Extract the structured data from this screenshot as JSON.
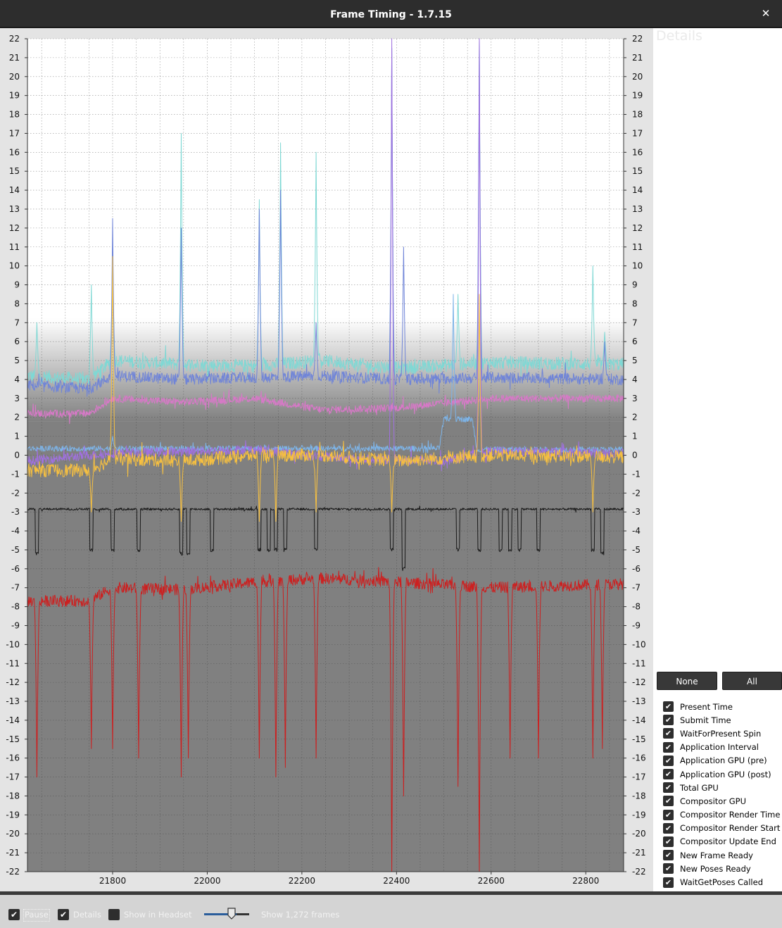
{
  "window": {
    "title": "Frame Timing - 1.7.15",
    "close_glyph": "✕"
  },
  "chart_data": {
    "type": "line",
    "title": "",
    "xlabel": "",
    "ylabel": "",
    "xlim": [
      21620,
      22880
    ],
    "ylim": [
      -22,
      22
    ],
    "x_ticks": [
      21800,
      22000,
      22200,
      22400,
      22600,
      22800
    ],
    "y_ticks": [
      -22,
      -21,
      -20,
      -19,
      -18,
      -17,
      -16,
      -15,
      -14,
      -13,
      -12,
      -11,
      -10,
      -9,
      -8,
      -7,
      -6,
      -5,
      -4,
      -3,
      -2,
      -1,
      0,
      1,
      2,
      3,
      4,
      5,
      6,
      7,
      8,
      9,
      10,
      11,
      12,
      13,
      14,
      15,
      16,
      17,
      18,
      19,
      20,
      21,
      22
    ],
    "grid": true,
    "background": {
      "bands": [
        {
          "from": 22,
          "to": 7.2,
          "color": "#ffffff"
        },
        {
          "from": 7.2,
          "to": 1.8,
          "color": "gradient-white-to-grey"
        },
        {
          "from": 1.8,
          "to": -22,
          "color": "#808080"
        }
      ]
    },
    "spikes_x": [
      21640,
      21755,
      21800,
      21855,
      21945,
      22110,
      22145,
      22165,
      22230,
      22390,
      22415,
      22530,
      22575,
      22640,
      22700,
      22815,
      22835
    ],
    "series": [
      {
        "name": "Total GPU",
        "color": "#7fd8d4",
        "baseline": [
          [
            21620,
            4.2
          ],
          [
            21750,
            4.0
          ],
          [
            21800,
            5.0
          ],
          [
            21950,
            4.8
          ],
          [
            22100,
            4.7
          ],
          [
            22240,
            5.0
          ],
          [
            22400,
            4.6
          ],
          [
            22600,
            4.9
          ],
          [
            22880,
            4.8
          ]
        ],
        "noise": 0.35,
        "spikes": [
          [
            21640,
            7.0
          ],
          [
            21755,
            9.0
          ],
          [
            21800,
            11.0
          ],
          [
            21945,
            17.0
          ],
          [
            22110,
            13.5
          ],
          [
            22155,
            16.5
          ],
          [
            22230,
            16.0
          ],
          [
            22390,
            21.5
          ],
          [
            22530,
            8.5
          ],
          [
            22575,
            22
          ],
          [
            22815,
            10.0
          ],
          [
            22840,
            6.5
          ]
        ]
      },
      {
        "name": "Application GPU (post)",
        "color": "#6f84d8",
        "baseline": [
          [
            21620,
            3.7
          ],
          [
            21750,
            3.5
          ],
          [
            21800,
            4.2
          ],
          [
            21950,
            4.0
          ],
          [
            22100,
            4.1
          ],
          [
            22240,
            4.2
          ],
          [
            22400,
            4.0
          ],
          [
            22600,
            4.1
          ],
          [
            22880,
            4.0
          ]
        ],
        "noise": 0.3,
        "spikes": [
          [
            21800,
            12.5
          ],
          [
            21945,
            12.0
          ],
          [
            22110,
            13.0
          ],
          [
            22155,
            14.0
          ],
          [
            22230,
            7.0
          ],
          [
            22390,
            21.5
          ],
          [
            22415,
            11.0
          ],
          [
            22575,
            22
          ],
          [
            22840,
            6.0
          ]
        ]
      },
      {
        "name": "Application GPU (pre)",
        "color": "#d878c8",
        "baseline": [
          [
            21620,
            2.2
          ],
          [
            21750,
            2.2
          ],
          [
            21800,
            3.0
          ],
          [
            21950,
            2.8
          ],
          [
            22100,
            3.0
          ],
          [
            22240,
            2.4
          ],
          [
            22400,
            2.5
          ],
          [
            22600,
            3.0
          ],
          [
            22880,
            3.0
          ]
        ],
        "noise": 0.2,
        "spikes": []
      },
      {
        "name": "Compositor GPU",
        "color": "#7db4e8",
        "baseline": [
          [
            21620,
            0.35
          ],
          [
            22490,
            0.35
          ],
          [
            22500,
            1.9
          ],
          [
            22560,
            1.9
          ],
          [
            22570,
            0.3
          ],
          [
            22880,
            0.3
          ]
        ],
        "noise": 0.15,
        "spikes": [
          [
            21800,
            1.0
          ],
          [
            22520,
            8.5
          ]
        ]
      },
      {
        "name": "Application Interval",
        "color": "#a070e0",
        "baseline": [
          [
            21620,
            -0.3
          ],
          [
            21800,
            0.1
          ],
          [
            22100,
            0.3
          ],
          [
            22300,
            -0.2
          ],
          [
            22500,
            -0.3
          ],
          [
            22600,
            0.2
          ],
          [
            22880,
            0.1
          ]
        ],
        "noise": 0.25,
        "spikes": [
          [
            22390,
            22
          ],
          [
            22575,
            22
          ]
        ]
      },
      {
        "name": "Present Time",
        "color": "#f7c040",
        "baseline": [
          [
            21620,
            -0.8
          ],
          [
            21750,
            -0.8
          ],
          [
            21800,
            -0.2
          ],
          [
            21950,
            -0.3
          ],
          [
            22100,
            0.0
          ],
          [
            22240,
            0.0
          ],
          [
            22400,
            -0.3
          ],
          [
            22600,
            0.0
          ],
          [
            22880,
            -0.1
          ]
        ],
        "noise": 0.35,
        "spikes": [
          [
            21755,
            -3.0
          ],
          [
            21800,
            10.5
          ],
          [
            21945,
            -3.5
          ],
          [
            22110,
            -3.5
          ],
          [
            22145,
            -3.5
          ],
          [
            22230,
            -3.0
          ],
          [
            22390,
            -3.0
          ],
          [
            22575,
            8.5
          ],
          [
            22815,
            -3.0
          ]
        ]
      },
      {
        "name": "New Frame Ready",
        "color": "#1a1a1a",
        "baseline": [
          [
            21620,
            -2.85
          ],
          [
            22880,
            -2.85
          ]
        ],
        "noise": 0.06,
        "drops": [
          [
            21640,
            -5.2
          ],
          [
            21755,
            -5.0
          ],
          [
            21800,
            -5.0
          ],
          [
            21855,
            -5.0
          ],
          [
            21945,
            -5.2
          ],
          [
            21960,
            -5.2
          ],
          [
            22010,
            -5.0
          ],
          [
            22110,
            -5.0
          ],
          [
            22130,
            -5.0
          ],
          [
            22145,
            -5.0
          ],
          [
            22165,
            -5.0
          ],
          [
            22230,
            -5.0
          ],
          [
            22390,
            -5.0
          ],
          [
            22415,
            -6.0
          ],
          [
            22530,
            -5.0
          ],
          [
            22575,
            -5.0
          ],
          [
            22620,
            -5.0
          ],
          [
            22640,
            -5.0
          ],
          [
            22660,
            -5.0
          ],
          [
            22700,
            -5.0
          ],
          [
            22815,
            -5.0
          ],
          [
            22835,
            -5.2
          ]
        ]
      },
      {
        "name": "WaitForPresent Spin",
        "color": "#cc2020",
        "baseline": [
          [
            21620,
            -7.7
          ],
          [
            21750,
            -7.7
          ],
          [
            21800,
            -7.0
          ],
          [
            21950,
            -7.1
          ],
          [
            22100,
            -6.7
          ],
          [
            22240,
            -6.5
          ],
          [
            22400,
            -6.7
          ],
          [
            22600,
            -7.0
          ],
          [
            22880,
            -6.8
          ]
        ],
        "noise": 0.3,
        "spikes": [
          [
            21640,
            -17.0
          ],
          [
            21755,
            -15.5
          ],
          [
            21800,
            -15.5
          ],
          [
            21855,
            -16.0
          ],
          [
            21945,
            -17.0
          ],
          [
            21960,
            -16.0
          ],
          [
            22110,
            -16.0
          ],
          [
            22145,
            -17.0
          ],
          [
            22165,
            -16.5
          ],
          [
            22230,
            -16.0
          ],
          [
            22390,
            -22
          ],
          [
            22415,
            -18.0
          ],
          [
            22530,
            -17.5
          ],
          [
            22575,
            -22
          ],
          [
            22640,
            -16.0
          ],
          [
            22700,
            -16.0
          ],
          [
            22815,
            -16.0
          ],
          [
            22835,
            -15.5
          ]
        ]
      }
    ]
  },
  "side_panel": {
    "details_title": "Details",
    "none_button": "None",
    "all_button": "All",
    "check_glyph": "✔",
    "series_toggles": [
      "Present Time",
      "Submit Time",
      "WaitForPresent Spin",
      "Application Interval",
      "Application GPU (pre)",
      "Application GPU (post)",
      "Total GPU",
      "Compositor GPU",
      "Compositor Render Time",
      "Compositor Render Start",
      "Compositor Update End",
      "New Frame Ready",
      "New Poses Ready",
      "WaitGetPoses Called"
    ]
  },
  "bottom_bar": {
    "pause_label": "Pause",
    "pause_checked": true,
    "details_label": "Details",
    "details_checked": true,
    "show_in_headset_label": "Show in Headset",
    "show_in_headset_checked": false,
    "frames_label": "Show 1,272 frames"
  }
}
